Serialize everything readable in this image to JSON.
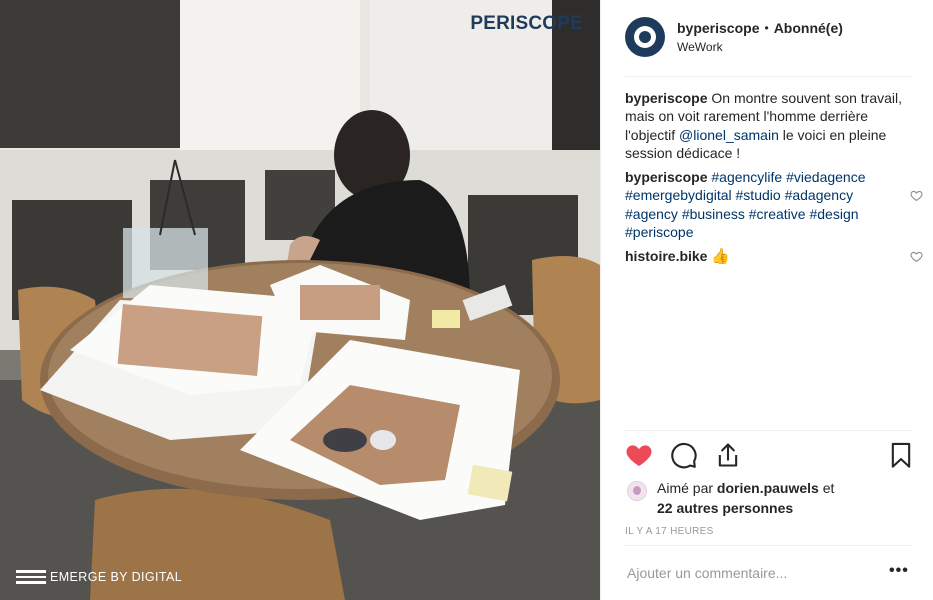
{
  "photo": {
    "watermark_brand": "PERISCOPE",
    "watermark_footer": "EMERGE BY DIGITAL"
  },
  "header": {
    "username": "byperiscope",
    "separator": "•",
    "follow_label": "Abonné(e)",
    "location": "WeWork",
    "brand_color": "#1f3b5c"
  },
  "caption": {
    "username": "byperiscope",
    "text_1": "On montre souvent son travail, mais on voit rarement l'homme derrière l'objectif",
    "mention": "@lionel_samain",
    "text_2": "le voici en pleine session dédicace !"
  },
  "comments": [
    {
      "username": "byperiscope",
      "hashtags": [
        "#agencylife",
        "#viedagence",
        "#emergebydigital",
        "#studio",
        "#adagency",
        "#agency",
        "#business",
        "#creative",
        "#design",
        "#periscope"
      ],
      "icon": "heart-outline-icon"
    },
    {
      "username": "histoire.bike",
      "emoji": "👍",
      "icon": "heart-outline-icon"
    }
  ],
  "actions": {
    "like_icon": "heart-filled-icon",
    "like_color": "#ed4956",
    "comment_icon": "comment-bubble-icon",
    "share_icon": "share-icon",
    "save_icon": "bookmark-icon"
  },
  "likes": {
    "prefix": "Aimé par",
    "liker": "dorien.pauwels",
    "conjunction": "et",
    "others": "22 autres personnes"
  },
  "timestamp": "IL Y A 17 HEURES",
  "add_comment": {
    "placeholder": "Ajouter un commentaire...",
    "more_label": "•••"
  }
}
